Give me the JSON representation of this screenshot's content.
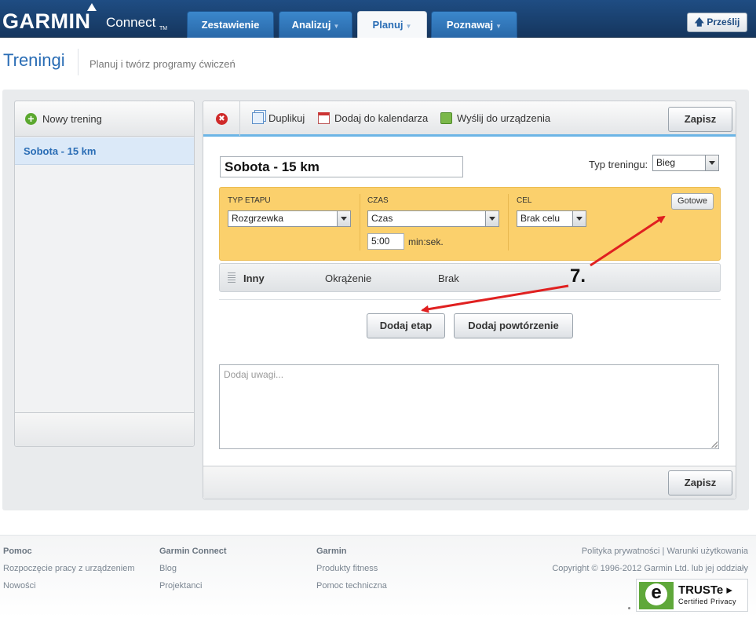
{
  "header": {
    "logo_main": "GARMIN",
    "logo_sub": "Connect",
    "logo_tm": "TM",
    "tabs": [
      {
        "label": "Zestawienie",
        "caret": false
      },
      {
        "label": "Analizuj",
        "caret": true
      },
      {
        "label": "Planuj",
        "caret": true,
        "active": true
      },
      {
        "label": "Poznawaj",
        "caret": true
      }
    ],
    "upload_label": "Prześlij"
  },
  "page": {
    "title": "Treningi",
    "subtitle": "Planuj i twórz programy ćwiczeń"
  },
  "sidebar": {
    "new_label": "Nowy trening",
    "items": [
      {
        "label": "Sobota - 15 km",
        "selected": true
      }
    ]
  },
  "toolbar": {
    "duplicate_label": "Duplikuj",
    "calendar_label": "Dodaj do kalendarza",
    "send_label": "Wyślij do urządzenia",
    "save_label": "Zapisz"
  },
  "workout": {
    "name": "Sobota - 15 km",
    "type_label": "Typ treningu:",
    "type_value": "Bieg"
  },
  "step_editor": {
    "col1_label": "TYP ETAPU",
    "col1_value": "Rozgrzewka",
    "col2_label": "CZAS",
    "col2_value": "Czas",
    "time_value": "5:00",
    "time_unit": "min:sek.",
    "col3_label": "CEL",
    "col3_value": "Brak celu",
    "done_label": "Gotowe"
  },
  "step_row": {
    "type": "Inny",
    "duration": "Okrążenie",
    "target": "Brak"
  },
  "actions": {
    "add_step": "Dodaj etap",
    "add_repeat": "Dodaj powtórzenie"
  },
  "notes": {
    "placeholder": "Dodaj uwagi..."
  },
  "annotation": {
    "label": "7.",
    "color": "#e02020"
  },
  "footer": {
    "col1": {
      "heading": "Pomoc",
      "links": [
        "Rozpoczęcie pracy z urządzeniem",
        "Nowości"
      ]
    },
    "col2": {
      "heading": "Garmin Connect",
      "links": [
        "Blog",
        "Projektanci"
      ]
    },
    "col3": {
      "heading": "Garmin",
      "links": [
        "Produkty fitness",
        "Pomoc techniczna"
      ]
    },
    "policy": "Polityka prywatności | Warunki użytkowania",
    "copyright": "Copyright © 1996-2012 Garmin Ltd. lub jej oddziały",
    "truste_title": "TRUSTe ▸",
    "truste_sub": "Certified Privacy"
  },
  "colors": {
    "brand": "#1f4d83",
    "accent": "#2a6db5",
    "step_bg": "#fbd06c"
  }
}
